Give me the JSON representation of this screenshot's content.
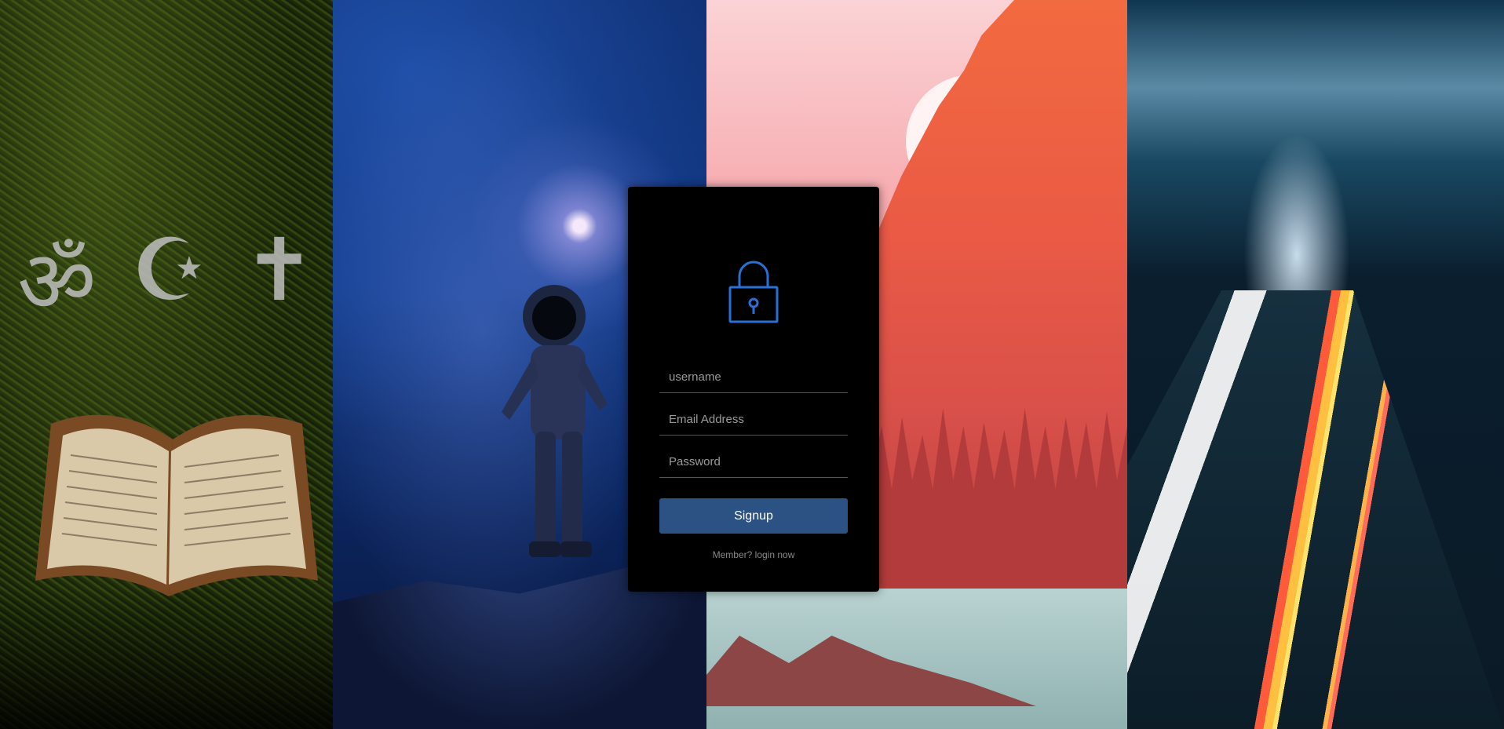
{
  "background": {
    "panels": [
      {
        "name": "religion-panel",
        "accent": "#2f4410"
      },
      {
        "name": "astronaut-panel",
        "accent": "#123a88"
      },
      {
        "name": "red-cliffs-panel",
        "accent": "#ea5a45"
      },
      {
        "name": "highway-panel",
        "accent": "#0b1a26"
      }
    ],
    "religion_symbols": [
      "ॐ",
      "☪",
      "✝"
    ]
  },
  "login": {
    "icon": "lock-icon",
    "icon_color": "#2a6fd6",
    "username_placeholder": "username",
    "email_placeholder": "Email Address",
    "password_placeholder": "Password",
    "submit_label": "Signup",
    "member_link": "Member? login now",
    "button_color": "#2b5283"
  }
}
